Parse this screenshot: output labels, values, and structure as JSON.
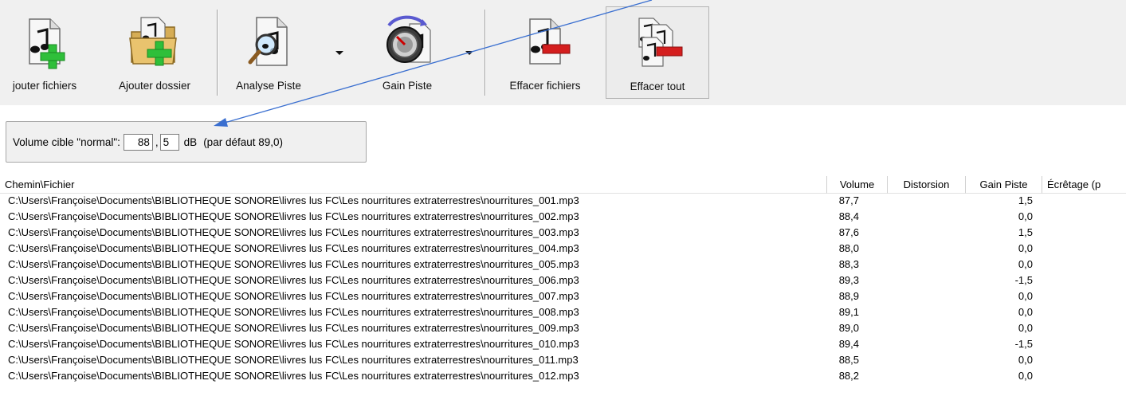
{
  "toolbar": {
    "add_files": "jouter fichiers",
    "add_folder": "Ajouter dossier",
    "analyze_track": "Analyse Piste",
    "gain_track": "Gain Piste",
    "clear_files": "Effacer fichiers",
    "clear_all": "Effacer tout"
  },
  "target": {
    "label": "Volume cible \"normal\":",
    "integer": "88",
    "separator": ",",
    "decimal": "5",
    "unit": "dB",
    "default_note": "(par défaut 89,0)"
  },
  "table": {
    "columns": [
      "Chemin\\Fichier",
      "Volume",
      "Distorsion",
      "Gain Piste",
      "Écrêtage (p"
    ],
    "rows": [
      {
        "path": "C:\\Users\\Françoise\\Documents\\BIBLIOTHEQUE SONORE\\livres lus FC\\Les nourritures extraterrestres\\nourritures_001.mp3",
        "volume": "87,7",
        "gain": "1,5"
      },
      {
        "path": "C:\\Users\\Françoise\\Documents\\BIBLIOTHEQUE SONORE\\livres lus FC\\Les nourritures extraterrestres\\nourritures_002.mp3",
        "volume": "88,4",
        "gain": "0,0"
      },
      {
        "path": "C:\\Users\\Françoise\\Documents\\BIBLIOTHEQUE SONORE\\livres lus FC\\Les nourritures extraterrestres\\nourritures_003.mp3",
        "volume": "87,6",
        "gain": "1,5"
      },
      {
        "path": "C:\\Users\\Françoise\\Documents\\BIBLIOTHEQUE SONORE\\livres lus FC\\Les nourritures extraterrestres\\nourritures_004.mp3",
        "volume": "88,0",
        "gain": "0,0"
      },
      {
        "path": "C:\\Users\\Françoise\\Documents\\BIBLIOTHEQUE SONORE\\livres lus FC\\Les nourritures extraterrestres\\nourritures_005.mp3",
        "volume": "88,3",
        "gain": "0,0"
      },
      {
        "path": "C:\\Users\\Françoise\\Documents\\BIBLIOTHEQUE SONORE\\livres lus FC\\Les nourritures extraterrestres\\nourritures_006.mp3",
        "volume": "89,3",
        "gain": "-1,5"
      },
      {
        "path": "C:\\Users\\Françoise\\Documents\\BIBLIOTHEQUE SONORE\\livres lus FC\\Les nourritures extraterrestres\\nourritures_007.mp3",
        "volume": "88,9",
        "gain": "0,0"
      },
      {
        "path": "C:\\Users\\Françoise\\Documents\\BIBLIOTHEQUE SONORE\\livres lus FC\\Les nourritures extraterrestres\\nourritures_008.mp3",
        "volume": "89,1",
        "gain": "0,0"
      },
      {
        "path": "C:\\Users\\Françoise\\Documents\\BIBLIOTHEQUE SONORE\\livres lus FC\\Les nourritures extraterrestres\\nourritures_009.mp3",
        "volume": "89,0",
        "gain": "0,0"
      },
      {
        "path": "C:\\Users\\Françoise\\Documents\\BIBLIOTHEQUE SONORE\\livres lus FC\\Les nourritures extraterrestres\\nourritures_010.mp3",
        "volume": "89,4",
        "gain": "-1,5"
      },
      {
        "path": "C:\\Users\\Françoise\\Documents\\BIBLIOTHEQUE SONORE\\livres lus FC\\Les nourritures extraterrestres\\nourritures_011.mp3",
        "volume": "88,5",
        "gain": "0,0"
      },
      {
        "path": "C:\\Users\\Françoise\\Documents\\BIBLIOTHEQUE SONORE\\livres lus FC\\Les nourritures extraterrestres\\nourritures_012.mp3",
        "volume": "88,2",
        "gain": "0,0"
      }
    ]
  },
  "icons": {
    "add_files": "music-file-plus-icon",
    "add_folder": "folder-plus-icon",
    "analyze_track": "music-file-magnifier-icon",
    "gain_track": "gain-knob-icon",
    "clear_files": "music-file-minus-icon",
    "clear_all": "music-files-minus-icon"
  },
  "colors": {
    "plus_green": "#2fbf3a",
    "minus_red": "#d41e1e",
    "annotation_blue": "#3a6fd0",
    "toolbar_bg": "#f0f0f0"
  }
}
